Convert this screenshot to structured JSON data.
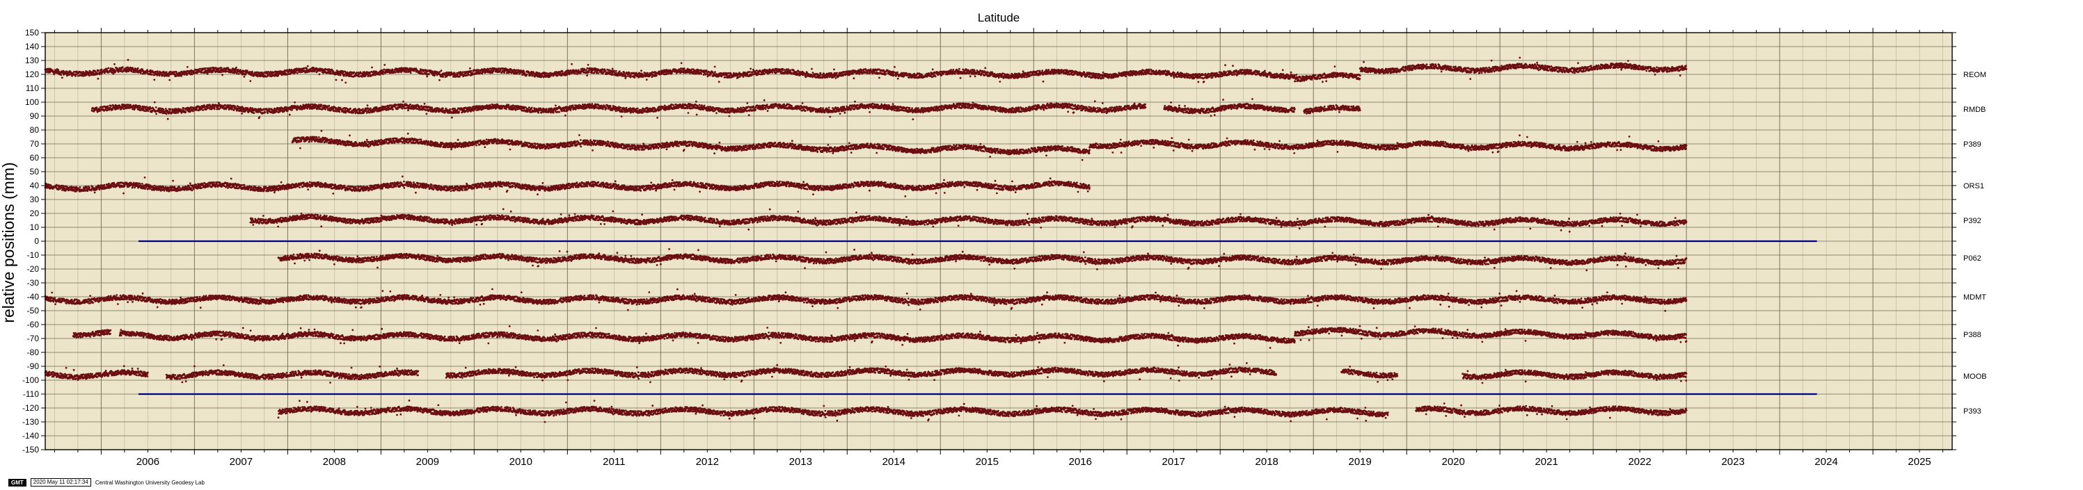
{
  "colors": {
    "background": "#ede5c9",
    "grid_major": "#6f6a58",
    "grid_minor": "#b8b19a",
    "points": "#6b0f12",
    "reference_line": "#00007f",
    "frame": "#000000"
  },
  "footer": {
    "logo": "GMT",
    "timestamp": "2020 May 11 02:17:34",
    "credit": "Central Washington University Geodesy Lab"
  },
  "chart_data": {
    "type": "scatter",
    "title": "Latitude",
    "xlabel": "",
    "ylabel": "relative positions (mm)",
    "xlim": [
      2005.4,
      2025.85
    ],
    "ylim": [
      -150,
      150
    ],
    "y_major_step": 10,
    "x_ticks": [
      "2006",
      "2007",
      "2008",
      "2009",
      "2010",
      "2011",
      "2012",
      "2013",
      "2014",
      "2015",
      "2016",
      "2017",
      "2018",
      "2019",
      "2020",
      "2021",
      "2022",
      "2023",
      "2024",
      "2025"
    ],
    "grid": true,
    "reference_lines": [
      {
        "y": 0,
        "x": [
          2006.4,
          2024.4
        ]
      },
      {
        "y": -110,
        "x": [
          2006.4,
          2024.4
        ]
      }
    ],
    "series": [
      {
        "name": "REOM",
        "label_y": 120,
        "segments": [
          {
            "x": [
              2005.4,
              2018.8
            ],
            "y": [
              122,
              120
            ]
          },
          {
            "x": [
              2018.8,
              2019.5
            ],
            "y": [
              118,
              118
            ]
          },
          {
            "x": [
              2019.5,
              2023.0
            ],
            "y": [
              124,
              125
            ]
          }
        ]
      },
      {
        "name": "RMDB",
        "label_y": 95,
        "segments": [
          {
            "x": [
              2005.9,
              2017.2
            ],
            "y": [
              95,
              96
            ]
          },
          {
            "x": [
              2017.4,
              2018.8
            ],
            "y": [
              95,
              96
            ]
          },
          {
            "x": [
              2018.9,
              2019.5
            ],
            "y": [
              94,
              95
            ]
          }
        ]
      },
      {
        "name": "P389",
        "label_y": 70,
        "segments": [
          {
            "x": [
              2008.05,
              2016.6
            ],
            "y": [
              72,
              65
            ]
          },
          {
            "x": [
              2016.6,
              2023.0
            ],
            "y": [
              70,
              68
            ]
          }
        ]
      },
      {
        "name": "ORS1",
        "label_y": 40,
        "segments": [
          {
            "x": [
              2005.4,
              2016.6
            ],
            "y": [
              39,
              40
            ]
          }
        ]
      },
      {
        "name": "P392",
        "label_y": 15,
        "segments": [
          {
            "x": [
              2007.6,
              2020.1
            ],
            "y": [
              16,
              14
            ]
          },
          {
            "x": [
              2020.1,
              2023.0
            ],
            "y": [
              14,
              14
            ]
          }
        ]
      },
      {
        "name": "P062",
        "label_y": -12,
        "segments": [
          {
            "x": [
              2007.9,
              2023.0
            ],
            "y": [
              -12,
              -14
            ]
          }
        ]
      },
      {
        "name": "MDMT",
        "label_y": -40,
        "segments": [
          {
            "x": [
              2005.4,
              2023.0
            ],
            "y": [
              -42,
              -42
            ]
          }
        ]
      },
      {
        "name": "P388",
        "label_y": -67,
        "segments": [
          {
            "x": [
              2005.7,
              2006.1
            ],
            "y": [
              -66,
              -66
            ]
          },
          {
            "x": [
              2006.2,
              2018.8
            ],
            "y": [
              -68,
              -70
            ]
          },
          {
            "x": [
              2018.8,
              2023.0
            ],
            "y": [
              -65,
              -68
            ]
          }
        ]
      },
      {
        "name": "MOOB",
        "label_y": -97,
        "segments": [
          {
            "x": [
              2005.4,
              2006.5
            ],
            "y": [
              -96,
              -96
            ]
          },
          {
            "x": [
              2006.7,
              2009.4
            ],
            "y": [
              -96,
              -96
            ]
          },
          {
            "x": [
              2009.7,
              2018.6
            ],
            "y": [
              -95,
              -94
            ]
          },
          {
            "x": [
              2019.3,
              2019.9
            ],
            "y": [
              -95,
              -95
            ]
          },
          {
            "x": [
              2020.6,
              2023.0
            ],
            "y": [
              -96,
              -96
            ]
          }
        ]
      },
      {
        "name": "P393",
        "label_y": -122,
        "segments": [
          {
            "x": [
              2007.9,
              2019.8
            ],
            "y": [
              -122,
              -123
            ]
          },
          {
            "x": [
              2020.1,
              2023.0
            ],
            "y": [
              -122,
              -122
            ]
          }
        ]
      }
    ]
  }
}
